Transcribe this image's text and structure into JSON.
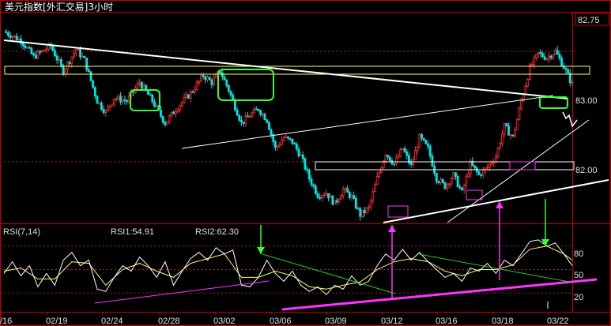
{
  "window": {
    "title": "美元指数[外汇交易]3小时"
  },
  "colors": {
    "background": "#000000",
    "panel_border": "#cc0000",
    "up": "#ff3030",
    "down": "#00e5e5",
    "rsi1": "#ffffff",
    "rsi2": "#ffff66",
    "trend_white": "#ffffff",
    "box_yellow": "#ffff66",
    "box_green": "#33ff33",
    "trend_green": "#22cc22",
    "trend_magenta": "#ff33ff",
    "arrow_magenta": "#ff33ff",
    "arrow_green": "#33ff33",
    "dashed_guides": "#aa2222"
  },
  "chart_data": [
    {
      "type": "candlestick",
      "title": "美元指数[外汇交易]3小时",
      "y_tick_labels": [
        "82.75",
        "83.00",
        "82.00"
      ],
      "ylim": [
        81.45,
        83.35
      ],
      "x_tick_labels": [
        "/16",
        "02/19",
        "02/24",
        "02/28",
        "03/02",
        "03/06",
        "03/09",
        "03/12",
        "03/16",
        "03/18",
        "03/22"
      ],
      "close_path": [
        [
          0,
          83.18
        ],
        [
          8,
          83.1
        ],
        [
          14,
          82.95
        ],
        [
          22,
          83.05
        ],
        [
          28,
          82.82
        ],
        [
          34,
          83.02
        ],
        [
          38,
          82.92
        ],
        [
          44,
          82.55
        ],
        [
          48,
          82.45
        ],
        [
          52,
          82.58
        ],
        [
          58,
          82.55
        ],
        [
          64,
          82.72
        ],
        [
          70,
          82.55
        ],
        [
          76,
          82.35
        ],
        [
          82,
          82.5
        ],
        [
          88,
          82.62
        ],
        [
          94,
          82.78
        ],
        [
          98,
          82.72
        ],
        [
          102,
          82.82
        ],
        [
          106,
          82.65
        ],
        [
          112,
          82.35
        ],
        [
          116,
          82.42
        ],
        [
          120,
          82.48
        ],
        [
          124,
          82.38
        ],
        [
          128,
          82.12
        ],
        [
          132,
          82.22
        ],
        [
          136,
          82.18
        ],
        [
          140,
          82.05
        ],
        [
          144,
          81.85
        ],
        [
          148,
          81.7
        ],
        [
          152,
          81.72
        ],
        [
          156,
          81.62
        ],
        [
          160,
          81.75
        ],
        [
          164,
          81.68
        ],
        [
          168,
          81.52
        ],
        [
          172,
          81.58
        ],
        [
          176,
          81.85
        ],
        [
          180,
          82.08
        ],
        [
          184,
          81.98
        ],
        [
          188,
          82.12
        ],
        [
          192,
          81.96
        ],
        [
          196,
          82.22
        ],
        [
          200,
          82.12
        ],
        [
          204,
          81.85
        ],
        [
          208,
          81.78
        ],
        [
          212,
          81.88
        ],
        [
          216,
          81.72
        ],
        [
          220,
          81.98
        ],
        [
          224,
          81.88
        ],
        [
          228,
          81.95
        ],
        [
          232,
          82.05
        ],
        [
          236,
          82.32
        ],
        [
          240,
          82.22
        ],
        [
          244,
          82.55
        ],
        [
          248,
          82.85
        ],
        [
          252,
          82.98
        ],
        [
          256,
          82.94
        ],
        [
          260,
          83.0
        ],
        [
          264,
          82.86
        ],
        [
          268,
          82.7
        ]
      ],
      "rsi": {
        "label": "RSI(7,14)",
        "rsi1_label": "RSI1:54.91",
        "rsi2_label": "RSI2:62.30",
        "ylim": [
          0,
          100
        ],
        "y_tick_labels": [
          "80",
          "50",
          "20"
        ],
        "rsi1_path": [
          [
            0,
            45
          ],
          [
            4,
            60
          ],
          [
            8,
            42
          ],
          [
            12,
            55
          ],
          [
            16,
            28
          ],
          [
            20,
            45
          ],
          [
            24,
            30
          ],
          [
            28,
            62
          ],
          [
            32,
            72
          ],
          [
            36,
            55
          ],
          [
            40,
            62
          ],
          [
            44,
            25
          ],
          [
            48,
            22
          ],
          [
            52,
            40
          ],
          [
            56,
            55
          ],
          [
            60,
            48
          ],
          [
            64,
            66
          ],
          [
            68,
            55
          ],
          [
            72,
            40
          ],
          [
            76,
            60
          ],
          [
            80,
            30
          ],
          [
            84,
            48
          ],
          [
            88,
            64
          ],
          [
            92,
            72
          ],
          [
            96,
            62
          ],
          [
            100,
            78
          ],
          [
            104,
            70
          ],
          [
            108,
            75
          ],
          [
            112,
            30
          ],
          [
            116,
            28
          ],
          [
            120,
            40
          ],
          [
            124,
            62
          ],
          [
            128,
            45
          ],
          [
            132,
            35
          ],
          [
            136,
            48
          ],
          [
            140,
            30
          ],
          [
            144,
            22
          ],
          [
            148,
            28
          ],
          [
            152,
            18
          ],
          [
            156,
            30
          ],
          [
            160,
            25
          ],
          [
            164,
            42
          ],
          [
            168,
            30
          ],
          [
            172,
            35
          ],
          [
            176,
            55
          ],
          [
            180,
            70
          ],
          [
            184,
            62
          ],
          [
            188,
            76
          ],
          [
            192,
            62
          ],
          [
            196,
            72
          ],
          [
            200,
            60
          ],
          [
            204,
            50
          ],
          [
            208,
            40
          ],
          [
            212,
            45
          ],
          [
            216,
            35
          ],
          [
            220,
            52
          ],
          [
            224,
            48
          ],
          [
            228,
            58
          ],
          [
            232,
            45
          ],
          [
            236,
            62
          ],
          [
            240,
            55
          ],
          [
            244,
            70
          ],
          [
            248,
            86
          ],
          [
            252,
            88
          ],
          [
            256,
            80
          ],
          [
            260,
            84
          ],
          [
            264,
            70
          ],
          [
            268,
            55
          ]
        ],
        "rsi2_path": [
          [
            0,
            48
          ],
          [
            8,
            52
          ],
          [
            16,
            38
          ],
          [
            24,
            38
          ],
          [
            32,
            60
          ],
          [
            40,
            58
          ],
          [
            48,
            30
          ],
          [
            56,
            50
          ],
          [
            64,
            58
          ],
          [
            72,
            48
          ],
          [
            80,
            40
          ],
          [
            88,
            58
          ],
          [
            96,
            64
          ],
          [
            104,
            70
          ],
          [
            112,
            40
          ],
          [
            120,
            40
          ],
          [
            128,
            48
          ],
          [
            136,
            42
          ],
          [
            144,
            28
          ],
          [
            152,
            25
          ],
          [
            160,
            30
          ],
          [
            168,
            34
          ],
          [
            176,
            50
          ],
          [
            184,
            60
          ],
          [
            192,
            64
          ],
          [
            200,
            60
          ],
          [
            208,
            48
          ],
          [
            216,
            42
          ],
          [
            224,
            50
          ],
          [
            232,
            50
          ],
          [
            240,
            56
          ],
          [
            248,
            76
          ],
          [
            256,
            80
          ],
          [
            264,
            70
          ],
          [
            268,
            62
          ]
        ]
      }
    }
  ]
}
